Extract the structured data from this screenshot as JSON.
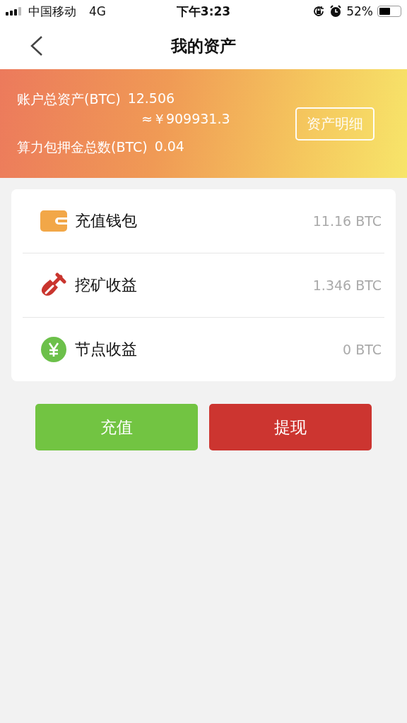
{
  "status_bar": {
    "carrier": "中国移动",
    "network": "4G",
    "time": "下午3:23",
    "battery": "52%"
  },
  "nav": {
    "title": "我的资产"
  },
  "summary": {
    "total_label": "账户总资产(BTC)",
    "total_value": "12.506",
    "converted": "≈￥909931.3",
    "deposit_label": "算力包押金总数(BTC)",
    "deposit_value": "0.04",
    "detail_button": "资产明细"
  },
  "assets": [
    {
      "kind": "wallet",
      "label": "充值钱包",
      "amount": "11.16 BTC"
    },
    {
      "kind": "mining",
      "label": "挖矿收益",
      "amount": "1.346 BTC"
    },
    {
      "kind": "node",
      "label": "节点收益",
      "amount": "0 BTC"
    }
  ],
  "buttons": [
    {
      "label": "充值",
      "color": "#72c442"
    },
    {
      "label": "提现",
      "color": "#cc3530"
    }
  ]
}
